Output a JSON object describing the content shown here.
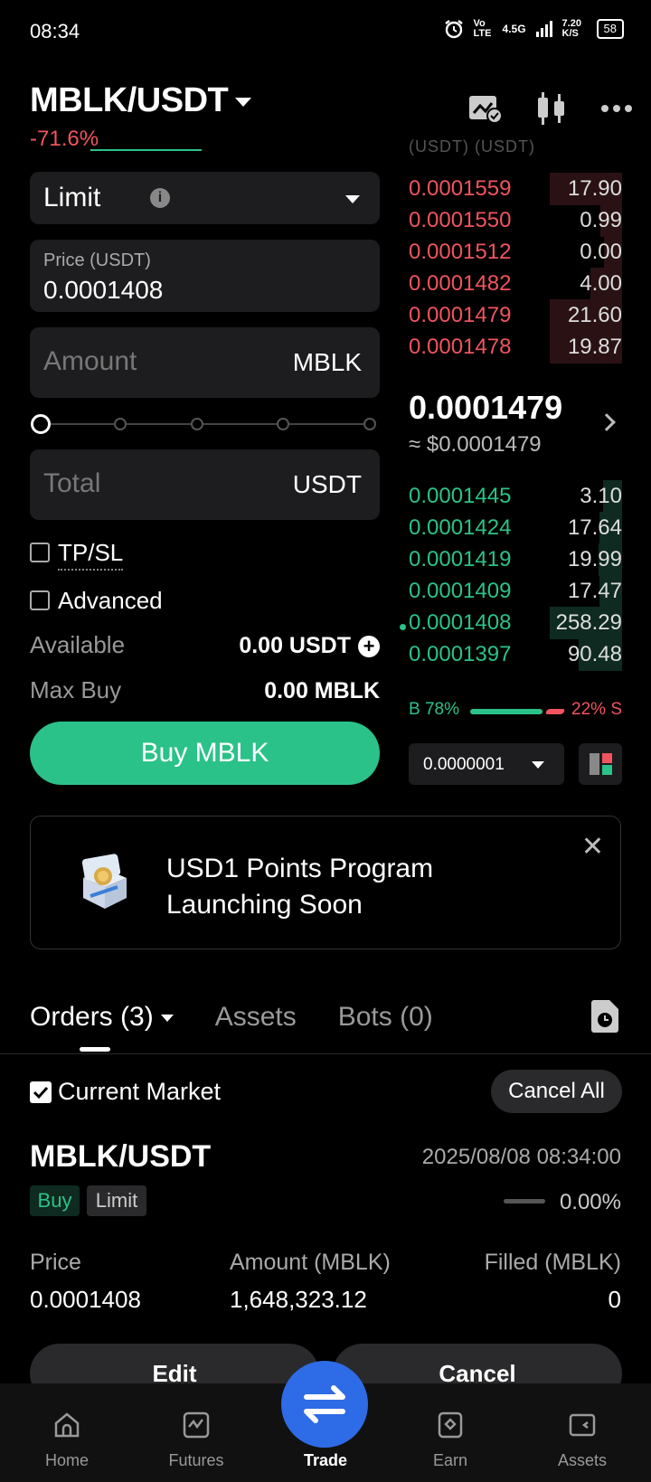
{
  "status_bar": {
    "time": "08:34",
    "net1": "Vo LTE",
    "net2": "4.5G",
    "speed": "7.20 K/S",
    "battery": "58"
  },
  "header": {
    "pair": "MBLK/USDT",
    "change": "-71.6%",
    "orderbook_cut": "(USDT)        (USDT)"
  },
  "form": {
    "order_type": "Limit",
    "price_label": "Price (USDT)",
    "price_value": "0.0001408",
    "amount_placeholder": "Amount",
    "amount_unit": "MBLK",
    "total_placeholder": "Total",
    "total_unit": "USDT",
    "tpsl_label": "TP/SL",
    "advanced_label": "Advanced",
    "available_label": "Available",
    "available_value": "0.00 USDT",
    "maxbuy_label": "Max Buy",
    "maxbuy_value": "0.00 MBLK",
    "buy_button": "Buy MBLK",
    "slider_percent": 0
  },
  "orderbook": {
    "asks": [
      {
        "price": "0.0001559",
        "qty": "17.90"
      },
      {
        "price": "0.0001550",
        "qty": "0.99"
      },
      {
        "price": "0.0001512",
        "qty": "0.00"
      },
      {
        "price": "0.0001482",
        "qty": "4.00"
      },
      {
        "price": "0.0001479",
        "qty": "21.60"
      },
      {
        "price": "0.0001478",
        "qty": "19.87"
      }
    ],
    "last_price": "0.0001479",
    "last_price_usd": "≈ $0.0001479",
    "bids": [
      {
        "price": "0.0001445",
        "qty": "3.10"
      },
      {
        "price": "0.0001424",
        "qty": "17.64"
      },
      {
        "price": "0.0001419",
        "qty": "19.99"
      },
      {
        "price": "0.0001409",
        "qty": "17.47"
      },
      {
        "price": "0.0001408",
        "qty": "258.29"
      },
      {
        "price": "0.0001397",
        "qty": "90.48"
      }
    ],
    "buy_ratio": "B 78%",
    "sell_ratio": "22% S",
    "precision": "0.0000001"
  },
  "promo": {
    "line1": "USD1 Points Program",
    "line2": "Launching Soon"
  },
  "tabs": {
    "orders": "Orders (3)",
    "assets": "Assets",
    "bots": "Bots (0)"
  },
  "orders_panel": {
    "current_market": "Current Market",
    "cancel_all": "Cancel All",
    "order": {
      "pair": "MBLK/USDT",
      "date": "2025/08/08 08:34:00",
      "side": "Buy",
      "type": "Limit",
      "filled_pct": "0.00%",
      "price_h": "Price",
      "price_v": "0.0001408",
      "amount_h": "Amount (MBLK)",
      "amount_v": "1,648,323.12",
      "filled_h": "Filled (MBLK)",
      "filled_v": "0",
      "edit": "Edit",
      "cancel": "Cancel"
    }
  },
  "nav": {
    "home": "Home",
    "futures": "Futures",
    "trade": "Trade",
    "earn": "Earn",
    "assets": "Assets"
  },
  "colors": {
    "green": "#2bc28a",
    "red": "#f0545f",
    "blue": "#2e6be6"
  }
}
